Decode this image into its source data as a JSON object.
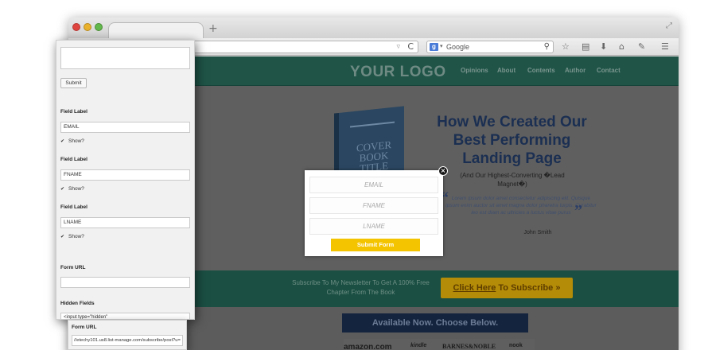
{
  "browser": {
    "new_tab": "+",
    "search": {
      "engine_badge": "g",
      "label": "Google"
    },
    "url_dropdown": "▿",
    "reload": "C",
    "resize": "⤢"
  },
  "site": {
    "logo": "YOUR LOGO",
    "nav": [
      "Opinions",
      "About",
      "Contents",
      "Author",
      "Contact"
    ],
    "book_cover_lines": [
      "COVER",
      "BOOK",
      "TITLE"
    ],
    "headline": "How We Created Our Best Performing Landing Page",
    "subhead": "(And Our Highest-Converting �Lead Magnet�)",
    "quote": "Lorem ipsum dolor amet consectetur adipiscing elit. Quisque ipsum enim auctor sit amet magna dolor pharetra turpis. Curabitur leo est diam ac ultricies a luctus vitae purus",
    "author": "John Smith",
    "band_text": "Subscribe To My Newsletter To Get A 100% Free Chapter From The Book",
    "cta_link": "Click Here",
    "cta_rest": " To Subscribe",
    "cta_arrows": "»",
    "available_heading": "Available Now. Choose Below.",
    "vendors": [
      "amazon.com",
      "kindle",
      "BARNES&NOBLE",
      "nook"
    ]
  },
  "modal": {
    "fields": [
      "EMAIL",
      "FNAME",
      "LNAME"
    ],
    "submit": "Submit Form",
    "close": "×"
  },
  "panel": {
    "submit": "Submit",
    "fields": [
      {
        "label": "Field Label",
        "value": "EMAIL",
        "show": "Show?"
      },
      {
        "label": "Field Label",
        "value": "FNAME",
        "show": "Show?"
      },
      {
        "label": "Field Label",
        "value": "LNAME",
        "show": "Show?"
      }
    ],
    "form_url_label": "Form URL",
    "hidden_fields_label": "Hidden Fields",
    "hidden_fields_value": "<input type=\"hidden\"",
    "second_form_url_label": "Form URL",
    "second_form_url_value": "//etechy101.us8.list-manage.com/subscribe/post?u="
  }
}
